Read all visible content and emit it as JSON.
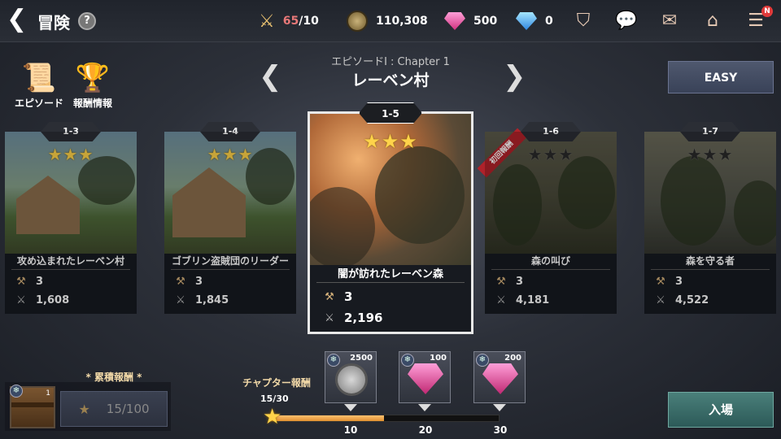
{
  "header": {
    "title": "冒険",
    "stamina_current": "65",
    "stamina_max": "/10",
    "gold": "110,308",
    "pink_gems": "500",
    "blue_gems": "0",
    "notification_badge": "N"
  },
  "left_buttons": {
    "episode_label": "エピソード",
    "reward_info_label": "報酬情報"
  },
  "chapter": {
    "subtitle": "エピソードI : Chapter 1",
    "title": "レーベン村"
  },
  "difficulty": {
    "label": "EASY"
  },
  "stages": [
    {
      "id": "1-3",
      "name": "攻め込まれたレーベン村",
      "cost": "3",
      "power": "1,608",
      "stars": 3
    },
    {
      "id": "1-4",
      "name": "ゴブリン盗賊団のリーダー",
      "cost": "3",
      "power": "1,845",
      "stars": 3
    },
    {
      "id": "1-5",
      "name": "闇が訪れたレーベン森",
      "cost": "3",
      "power": "2,196",
      "stars": 3
    },
    {
      "id": "1-6",
      "name": "森の叫び",
      "cost": "3",
      "power": "4,181",
      "stars": 0,
      "ribbon": "初回報酬"
    },
    {
      "id": "1-7",
      "name": "森を守る者",
      "cost": "3",
      "power": "4,522",
      "stars": 0
    }
  ],
  "cumulative_reward": {
    "label": "* 累積報酬 *",
    "chest_count": "1",
    "progress": "15/100"
  },
  "chapter_reward": {
    "label": "チャプター報酬",
    "count": "15/30",
    "progress_fraction": 0.5,
    "rewards": [
      {
        "amount": "2500",
        "type": "coin",
        "tick": "10"
      },
      {
        "amount": "100",
        "type": "gem",
        "tick": "20"
      },
      {
        "amount": "200",
        "type": "gem",
        "tick": "30"
      }
    ]
  },
  "enter_button": {
    "label": "入場"
  },
  "colors": {
    "gold_star": "#ffd34a",
    "accent_teal": "#4a7f7a",
    "stamina_red": "#e87878"
  }
}
